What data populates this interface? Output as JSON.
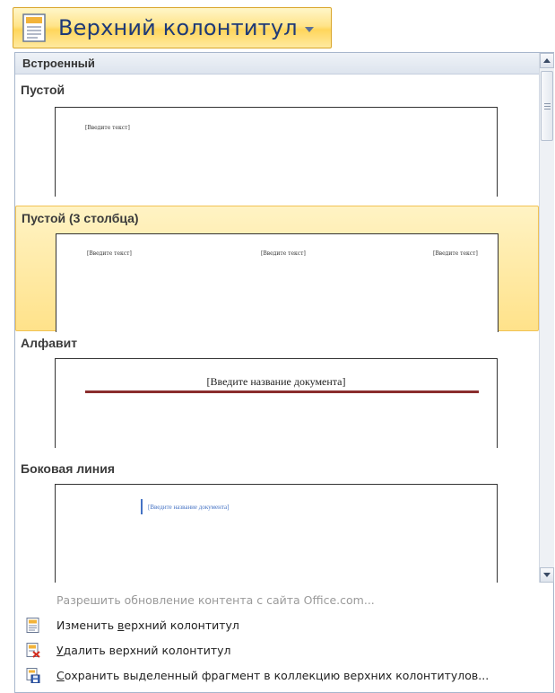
{
  "ribbon_button": {
    "label": "Верхний колонтитул"
  },
  "gallery": {
    "section_header": "Встроенный",
    "items": [
      {
        "title": "Пустой",
        "placeholders": [
          "[Введите текст]"
        ]
      },
      {
        "title": "Пустой (3 столбца)",
        "placeholders": [
          "[Введите текст]",
          "[Введите текст]",
          "[Введите текст]"
        ],
        "selected": true
      },
      {
        "title": "Алфавит",
        "placeholders": [
          "[Введите название документа]"
        ],
        "rule_color": "#8a2d2d"
      },
      {
        "title": "Боковая линия",
        "placeholders": [
          "[Введите название документа]"
        ],
        "accent_color": "#4472c4"
      }
    ]
  },
  "menu": {
    "items": [
      {
        "label": "Разрешить обновление контента с сайта Office.com...",
        "enabled": false
      },
      {
        "label_pre": "Изменить ",
        "label_acc": "в",
        "label_post": "ерхний колонтитул",
        "enabled": true,
        "icon": "header-page-icon"
      },
      {
        "label_pre": "",
        "label_acc": "У",
        "label_post": "далить верхний колонтитул",
        "enabled": true,
        "icon": "delete-header-icon"
      },
      {
        "label_pre": "",
        "label_acc": "С",
        "label_post": "охранить выделенный фрагмент в коллекцию верхних колонтитулов...",
        "enabled": true,
        "icon": "save-selection-icon"
      }
    ]
  },
  "colors": {
    "accent_blue": "#1e3a78",
    "hover_highlight": "#ffe28a",
    "disabled_text": "#9a9a9a"
  }
}
